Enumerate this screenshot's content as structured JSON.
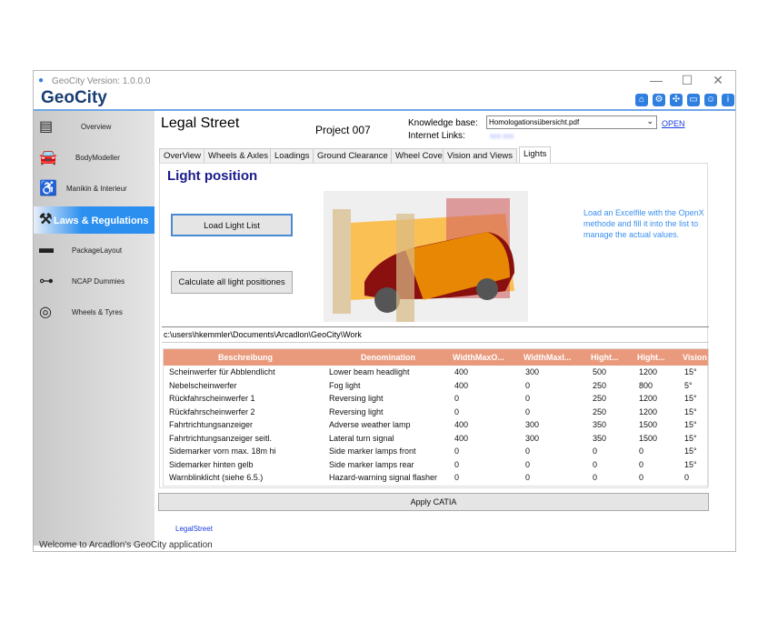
{
  "window": {
    "title": "GeoCity Version: 1.0.0.0",
    "logo": "GeoCity",
    "controls": {
      "minimize": "—",
      "maximize": "☐",
      "close": "✕"
    }
  },
  "toolbar_icons": [
    "home-icon",
    "gear-icon",
    "network-icon",
    "window-icon",
    "person-icon",
    "info-icon"
  ],
  "sidebar": {
    "items": [
      {
        "label": "Overview",
        "icon": "clipboard-icon"
      },
      {
        "label": "BodyModeller",
        "icon": "car-icon"
      },
      {
        "label": "Manikin & Interieur",
        "icon": "manikin-icon"
      },
      {
        "label": "Laws & Regulations",
        "icon": "gavel-icon",
        "selected": true
      },
      {
        "label": "PackageLayout",
        "icon": "package-icon"
      },
      {
        "label": "NCAP Dummies",
        "icon": "dummy-icon"
      },
      {
        "label": "Wheels & Tyres",
        "icon": "tyre-icon"
      }
    ]
  },
  "header": {
    "title": "Legal Street",
    "project": "Project 007",
    "kb_label": "Knowledge base:",
    "kb_value": "Homologationsübersicht.pdf",
    "open": "OPEN",
    "links_label": "Internet Links:",
    "links_value": "sss.sss"
  },
  "tabs": [
    "OverView",
    "Wheels & Axles",
    "Loadings",
    "Ground Clearance",
    "Wheel Cover",
    "Vision and Views",
    "Lights"
  ],
  "lights": {
    "heading": "Light position",
    "load_btn": "Load Light List",
    "calc_btn": "Calculate all light positiones",
    "info": "Load an Excelfile with the OpenX methode and fill it into the list to manage the actual values.",
    "path": "c:\\users\\hkemmler\\Documents\\Arcadlon\\GeoCity\\Work"
  },
  "table": {
    "columns": [
      "Beschreibung",
      "Denomination",
      "WidthMaxO...",
      "WidthMaxI...",
      "Hight...",
      "Hight...",
      "Vision"
    ],
    "rows": [
      [
        "Scheinwerfer für Abblendlicht",
        "Lower beam headlight",
        "400",
        "300",
        "500",
        "1200",
        "15°"
      ],
      [
        "Nebelscheinwerfer",
        "Fog light",
        "400",
        "0",
        "250",
        "800",
        "5°"
      ],
      [
        "Rückfahrscheinwerfer 1",
        "Reversing light",
        "0",
        "0",
        "250",
        "1200",
        "15°"
      ],
      [
        "Rückfahrscheinwerfer 2",
        "Reversing light",
        "0",
        "0",
        "250",
        "1200",
        "15°"
      ],
      [
        "Fahrtrichtungsanzeiger",
        "Adverse weather lamp",
        "400",
        "300",
        "350",
        "1500",
        "15°"
      ],
      [
        "Fahrtrichtungsanzeiger seitl.",
        "Lateral turn signal",
        "400",
        "300",
        "350",
        "1500",
        "15°"
      ],
      [
        "Sidemarker vorn max. 18m hi",
        "Side marker lamps front",
        "0",
        "0",
        "0",
        "0",
        "15°"
      ],
      [
        "Sidemarker hinten gelb",
        "Side marker lamps rear",
        "0",
        "0",
        "0",
        "0",
        "15°"
      ],
      [
        "Warnblinklicht (siehe 6.5.)",
        "Hazard-warning signal flasher",
        "0",
        "0",
        "0",
        "0",
        "0"
      ]
    ]
  },
  "apply_btn": "Apply CATIA",
  "footer": {
    "link": "LegalStreet",
    "status": "Welcome to Arcadlon's GeoCity application"
  },
  "colors": {
    "accent": "#2b8ff0",
    "header": "#ea9a7c",
    "title": "#1a1a8c",
    "link": "#1a3ee0"
  }
}
